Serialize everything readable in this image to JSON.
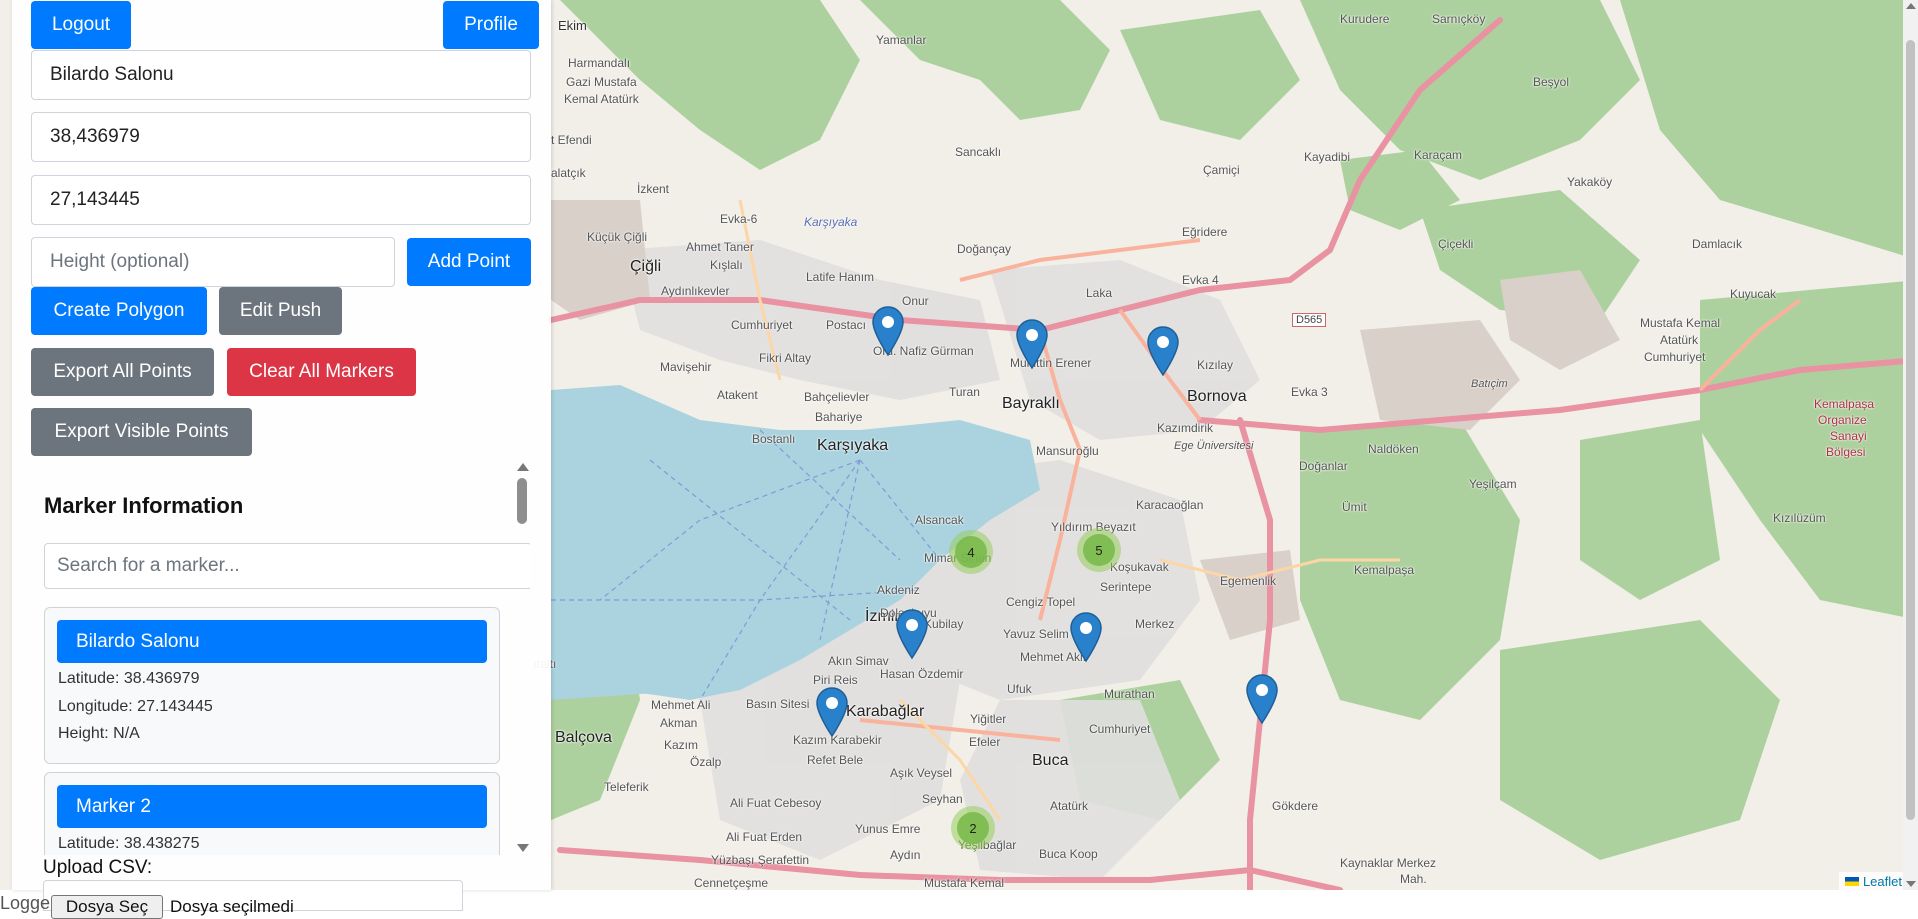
{
  "header": {
    "logout_label": "Logout",
    "profile_label": "Profile"
  },
  "form": {
    "name_value": "Bilardo Salonu",
    "latitude_value": "38,436979",
    "longitude_value": "27,143445",
    "height_placeholder": "Height (optional)",
    "add_point_label": "Add Point",
    "create_polygon_label": "Create Polygon",
    "edit_push_label": "Edit Push",
    "export_all_label": "Export All Points",
    "clear_all_label": "Clear All Markers",
    "export_visible_label": "Export Visible Points"
  },
  "markers_panel": {
    "title": "Marker Information",
    "search_placeholder": "Search for a marker...",
    "cards": [
      {
        "name": "Bilardo Salonu",
        "latitude": "Latitude: 38.436979",
        "longitude": "Longitude: 27.143445",
        "height": "Height: N/A"
      },
      {
        "name": "Marker 2",
        "latitude": "Latitude: 38.438275"
      }
    ]
  },
  "upload": {
    "label": "Upload CSV:",
    "choose_button": "Dosya Seç",
    "status": "Dosya seçilmedi",
    "partial_text": "Logge"
  },
  "map": {
    "attribution": "Leaflet",
    "clusters": [
      "4",
      "5",
      "2"
    ],
    "places": {
      "ekim": "Ekim",
      "yamanlar": "Yamanlar",
      "kurudere": "Kurudere",
      "sarnickoy": "Sarnıçköy",
      "besyol": "Beşyol",
      "harmandali": "Harmandalı",
      "gazi_mustafa": "Gazi Mustafa",
      "kemal_ataturk": "Kemal Atatürk",
      "efendi": "t Efendi",
      "balatcik": "alatçık",
      "izkent": "İzkent",
      "sancakli": "Sancaklı",
      "kayadibi": "Kayadibi",
      "karacam": "Karaçam",
      "camici": "Çamiçi",
      "yakakoy": "Yakaköy",
      "evka6": "Evka-6",
      "karsiyaka_it": "Karşıyaka",
      "kucuk_cigli": "Küçük Çiğli",
      "ahmet_taner": "Ahmet Taner",
      "kislali": "Kışlalı",
      "cigli": "Çiğli",
      "dogancay": "Doğançay",
      "egridere": "Eğridere",
      "cicekli": "Çiçekli",
      "damlacik": "Damlacık",
      "kuyucak": "Kuyucak",
      "evka4": "Evka 4",
      "aydinlikevler": "Aydınlıkevler",
      "latife_hanim": "Latife Hanım",
      "onur": "Onur",
      "laka": "Laka",
      "cumhuriyet": "Cumhuriyet",
      "postacilar": "Postacı",
      "fikri_altay": "Fikri Altay",
      "ord_nafiz": "Ord. Nafiz Gürman",
      "mustafa_kemal_ataturk": "Mustafa Kemal",
      "ataturk2": "Atatürk",
      "cumhuriyet2": "Cumhuriyet",
      "kemalpasa_organize": "Kemalpaşa",
      "organize": "Organize",
      "sanayi": "Sanayi",
      "bolgesi": "Bölgesi",
      "mavisehir": "Mavişehir",
      "muhittin": "Muhittin Erener",
      "kizilay": "Kızılay",
      "bornova": "Bornova",
      "evka3": "Evka 3",
      "baticim": "Batıçim",
      "atakent": "Atakent",
      "bahcelievler": "Bahçelievler",
      "turan": "Turan",
      "bayrakli": "Bayraklı",
      "kazimdirik": "Kazımdirik",
      "bahariye": "Bahariye",
      "bostanli": "Bostanlı",
      "karsiyaka": "Karşıyaka",
      "mansuroglu": "Mansuroğlu",
      "ege_uni": "Ege Üniversitesi",
      "doganlar": "Doğanlar",
      "naldoken": "Naldöken",
      "yesilcam": "Yeşilçam",
      "karacaoglan": "Karacaoğlan",
      "umit": "Ümit",
      "kiziluzum": "Kızılüzüm",
      "alsancak": "Alsancak",
      "yildirim": "Yıldırım Beyazıt",
      "mimar": "Mimar Sinan",
      "kosukavak": "Koşukavak",
      "egemenlik": "Egemenlik",
      "kemalpasa": "Kemalpaşa",
      "akdeniz": "Akdeniz",
      "serintepe": "Serintepe",
      "cengiz": "Cengiz Topel",
      "izmir": "İzmir",
      "kubilay": "Kubilay",
      "merkez": "Merkez",
      "dolapkuyu": "Dolapkuyu",
      "yavuz": "Yavuz Selim",
      "mehmet_akif": "Mehmet Akif",
      "akin_simav": "Akın Simav",
      "hasan_ozdemir": "Hasan Özdemir",
      "piri_reis": "Piri Reis",
      "murathan": "Murathan",
      "ufuk": "Ufuk",
      "basin": "Basın Sitesi",
      "karabaglar": "Karabağlar",
      "mehmet_ali": "Mehmet Ali",
      "akman": "Akman",
      "balcova": "Balçova",
      "kazim_karabekir": "Kazım Karabekir",
      "yigitler": "Yiğitler",
      "efeler": "Efeler",
      "cumhuriyet3": "Cumhuriyet",
      "kazim": "Kazım",
      "ozalp": "Özalp",
      "refet": "Refet Bele",
      "asik": "Aşık Veysel",
      "buca": "Buca",
      "teleferik": "Teleferik",
      "seyhan": "Seyhan",
      "gokdere": "Gökdere",
      "ali_fuat": "Ali Fuat Cebesoy",
      "ataturk3": "Atatürk",
      "ali_fuat_erden": "Ali Fuat Erden",
      "yunus_emre": "Yunus Emre",
      "yesilbaglar": "Yeşilbağlar",
      "buca_koop": "Buca Koop",
      "yuzbasi": "Yüzbaşı Şerafettin",
      "aydin": "Aydın",
      "kaynaklar": "Kaynaklar Merkez",
      "mah": "Mah.",
      "cennetcesme": "Cennetçeşme",
      "mustafa_kemal2": "Mustafa Kemal",
      "izmir_edge": "ıraltı",
      "d565": "D565"
    }
  }
}
